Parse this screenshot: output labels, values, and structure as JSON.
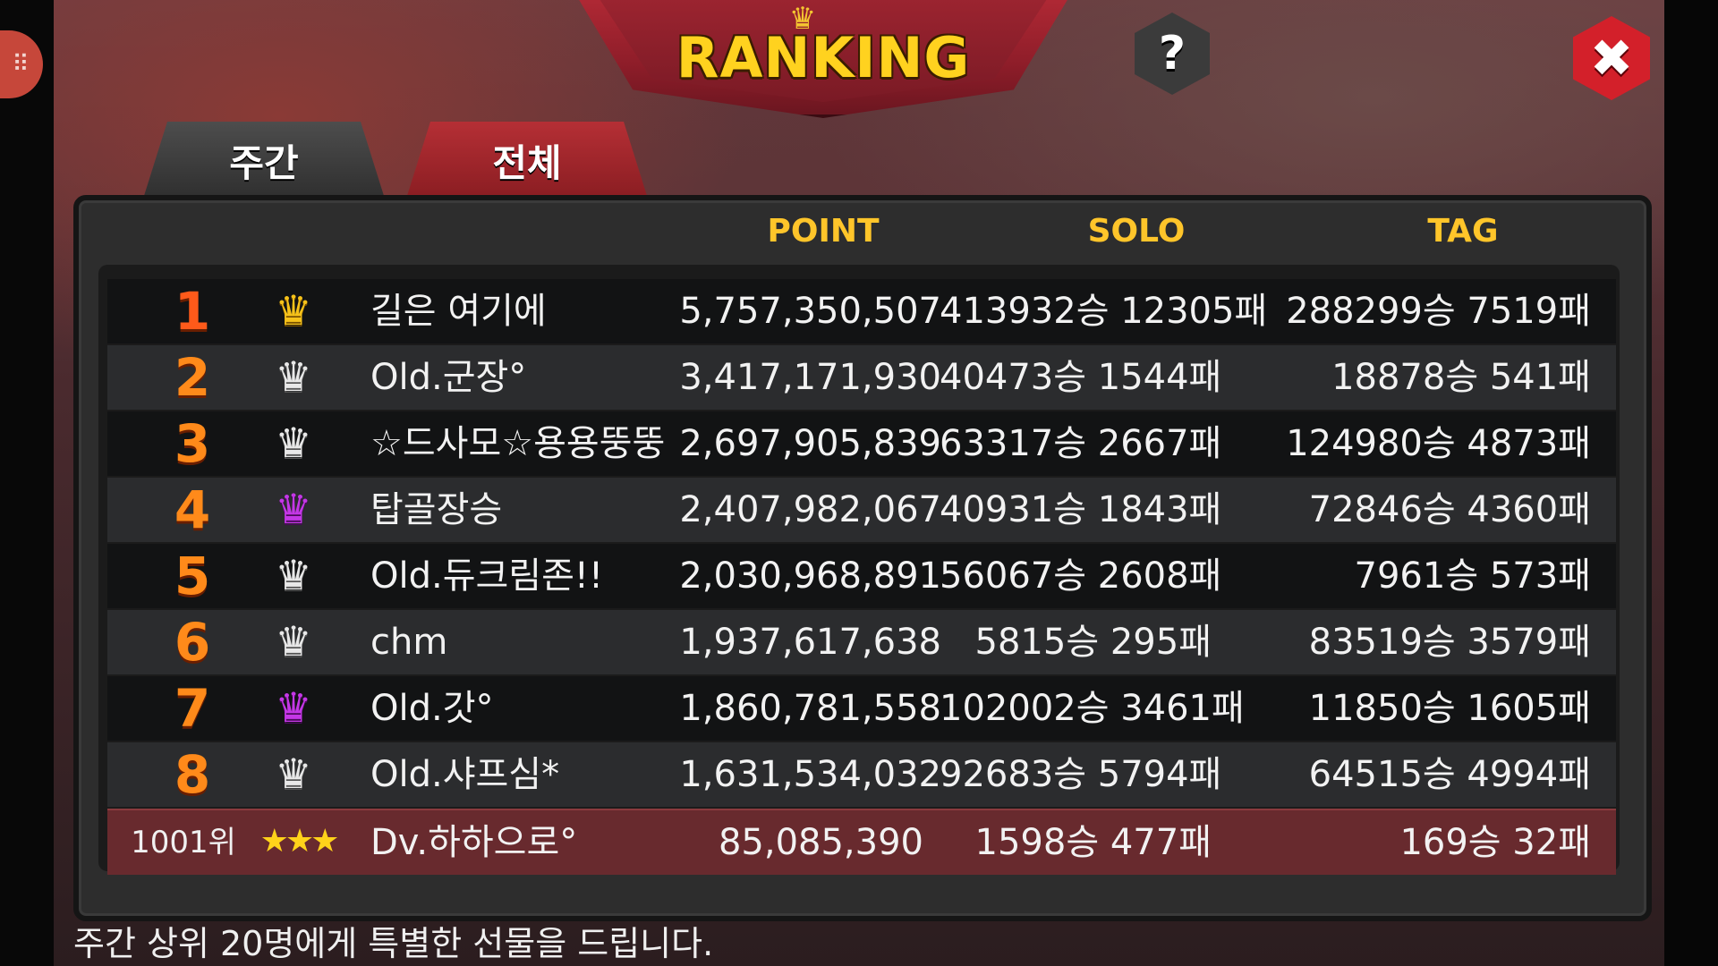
{
  "header": {
    "title": "RANKING",
    "help_label": "?",
    "close_label": "✖"
  },
  "tabs": [
    {
      "label": "주간",
      "active": true
    },
    {
      "label": "전체",
      "active": false
    }
  ],
  "columns": {
    "point": "POINT",
    "solo": "SOLO",
    "tag": "TAG"
  },
  "rows": [
    {
      "rank": "1",
      "badge": "gold-crown",
      "name": "길은 여기에",
      "point": "5,757,350,507",
      "solo": "413932승 12305패",
      "tag": "288299승 7519패"
    },
    {
      "rank": "2",
      "badge": "silver-crown",
      "name": "Old.군장°",
      "point": "3,417,171,930",
      "solo": "40473승 1544패",
      "tag": "18878승 541패"
    },
    {
      "rank": "3",
      "badge": "silver-crown",
      "name": "☆드사모☆용용뚱뚱",
      "point": "2,697,905,839",
      "solo": "63317승 2667패",
      "tag": "124980승 4873패"
    },
    {
      "rank": "4",
      "badge": "purple-crown",
      "name": "탑골장승",
      "point": "2,407,982,067",
      "solo": "40931승 1843패",
      "tag": "72846승 4360패"
    },
    {
      "rank": "5",
      "badge": "silver-crown",
      "name": "Old.듀크림존!!",
      "point": "2,030,968,891",
      "solo": "56067승 2608패",
      "tag": "7961승 573패"
    },
    {
      "rank": "6",
      "badge": "silver-crown",
      "name": "chm",
      "point": "1,937,617,638",
      "solo": "5815승 295패",
      "tag": "83519승 3579패"
    },
    {
      "rank": "7",
      "badge": "purple-crown",
      "name": "Old.갓°",
      "point": "1,860,781,558",
      "solo": "102002승 3461패",
      "tag": "11850승 1605패"
    },
    {
      "rank": "8",
      "badge": "silver-crown",
      "name": "Old.샤프심*",
      "point": "1,631,534,032",
      "solo": "92683승 5794패",
      "tag": "64515승 4994패"
    }
  ],
  "my_row": {
    "rank": "1001위",
    "badge": "three-stars",
    "stars": "★★★",
    "name": "Dv.하하으로°",
    "point": "85,085,390",
    "solo": "1598승 477패",
    "tag": "169승 32패"
  },
  "footer": {
    "note": "주간 상위 20명에게 특별한 선물을 드립니다."
  },
  "icons": {
    "crown": "♛"
  },
  "colors": {
    "accent_gold": "#ffc52a",
    "tab_active": "#4d4d4d",
    "tab_inactive": "#b52f35",
    "my_row_bg": "#682a2e",
    "rank_orange": "#ff8a1a"
  }
}
